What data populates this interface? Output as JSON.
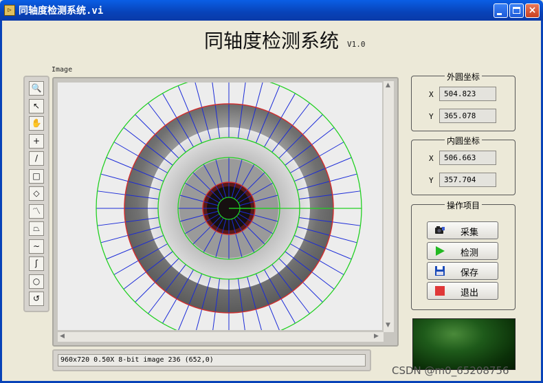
{
  "window": {
    "icon_text": "▷",
    "title": "同轴度检测系统.vi",
    "buttons": {
      "close": "×"
    }
  },
  "app": {
    "title": "同轴度检测系统",
    "version": "V1.0"
  },
  "image_display": {
    "label": "Image",
    "status": "960x720 0.50X 8-bit image 236    (652,0)"
  },
  "tools": [
    {
      "icon": "zoom-icon",
      "glyph": "🔍"
    },
    {
      "icon": "pointer-icon",
      "glyph": "↖"
    },
    {
      "icon": "pan-hand-icon",
      "glyph": "✋"
    },
    {
      "icon": "crosshair-point-icon",
      "glyph": "+"
    },
    {
      "icon": "line-tool-icon",
      "glyph": "/"
    },
    {
      "icon": "rectangle-tool-icon",
      "glyph": "□"
    },
    {
      "icon": "rotated-rectangle-tool-icon",
      "glyph": "◇"
    },
    {
      "icon": "polyline-tool-icon",
      "glyph": "〽"
    },
    {
      "icon": "polygon-tool-icon",
      "glyph": "⏢"
    },
    {
      "icon": "freehand-line-tool-icon",
      "glyph": "∼"
    },
    {
      "icon": "freehand-region-tool-icon",
      "glyph": "ʃ"
    },
    {
      "icon": "oval-tool-icon",
      "glyph": "○"
    },
    {
      "icon": "annulus-tool-icon",
      "glyph": "↺"
    }
  ],
  "outer_circle": {
    "label": "外圆坐标",
    "x_label": "X",
    "x": "504.823",
    "y_label": "Y",
    "y": "365.078"
  },
  "inner_circle": {
    "label": "内圆坐标",
    "x_label": "X",
    "x": "506.663",
    "y_label": "Y",
    "y": "357.704"
  },
  "operations": {
    "label": "操作项目",
    "acquire": "采集",
    "inspect": "检测",
    "save": "保存",
    "exit": "退出"
  },
  "colors": {
    "detection_rings": "#22d022",
    "rake_lines": "#1a2ad8",
    "fitted_circle": "#d03030",
    "play_icon": "#22b922",
    "stop_icon": "#e03838",
    "save_icon": "#1a4ab8"
  },
  "watermark": "CSDN @m0_65208756"
}
